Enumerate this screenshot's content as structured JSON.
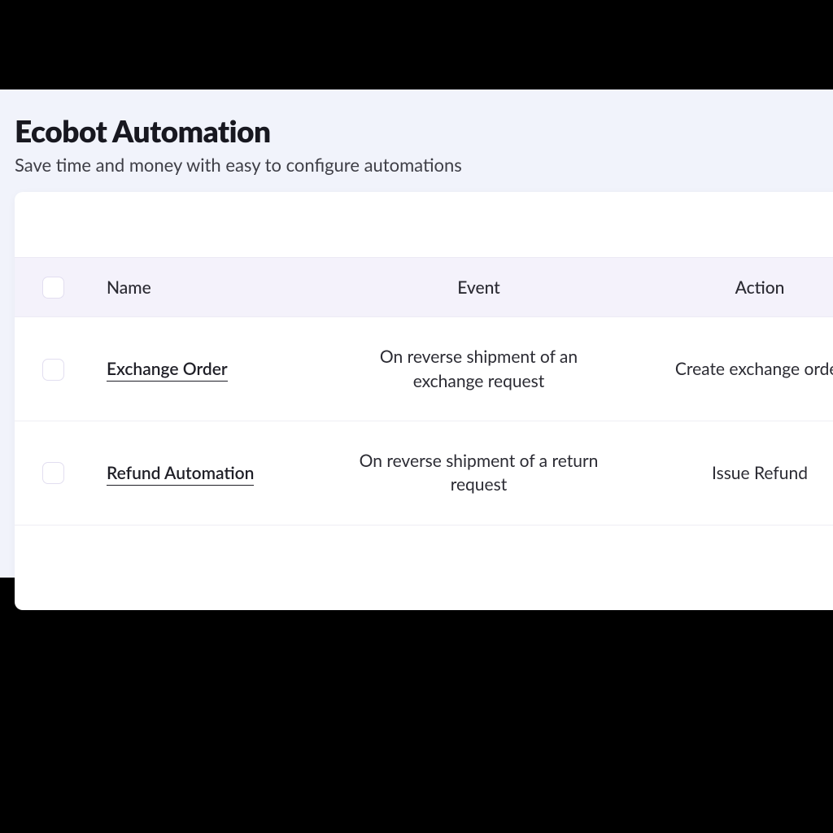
{
  "header": {
    "title": "Ecobot Automation",
    "subtitle": "Save time and money with easy to configure automations"
  },
  "table": {
    "columns": {
      "name": "Name",
      "event": "Event",
      "action": "Action"
    },
    "rows": [
      {
        "name": "Exchange Order",
        "event": "On reverse shipment of an exchange request",
        "action": "Create exchange order"
      },
      {
        "name": "Refund Automation",
        "event": "On reverse shipment of a return request",
        "action": "Issue Refund"
      }
    ]
  }
}
